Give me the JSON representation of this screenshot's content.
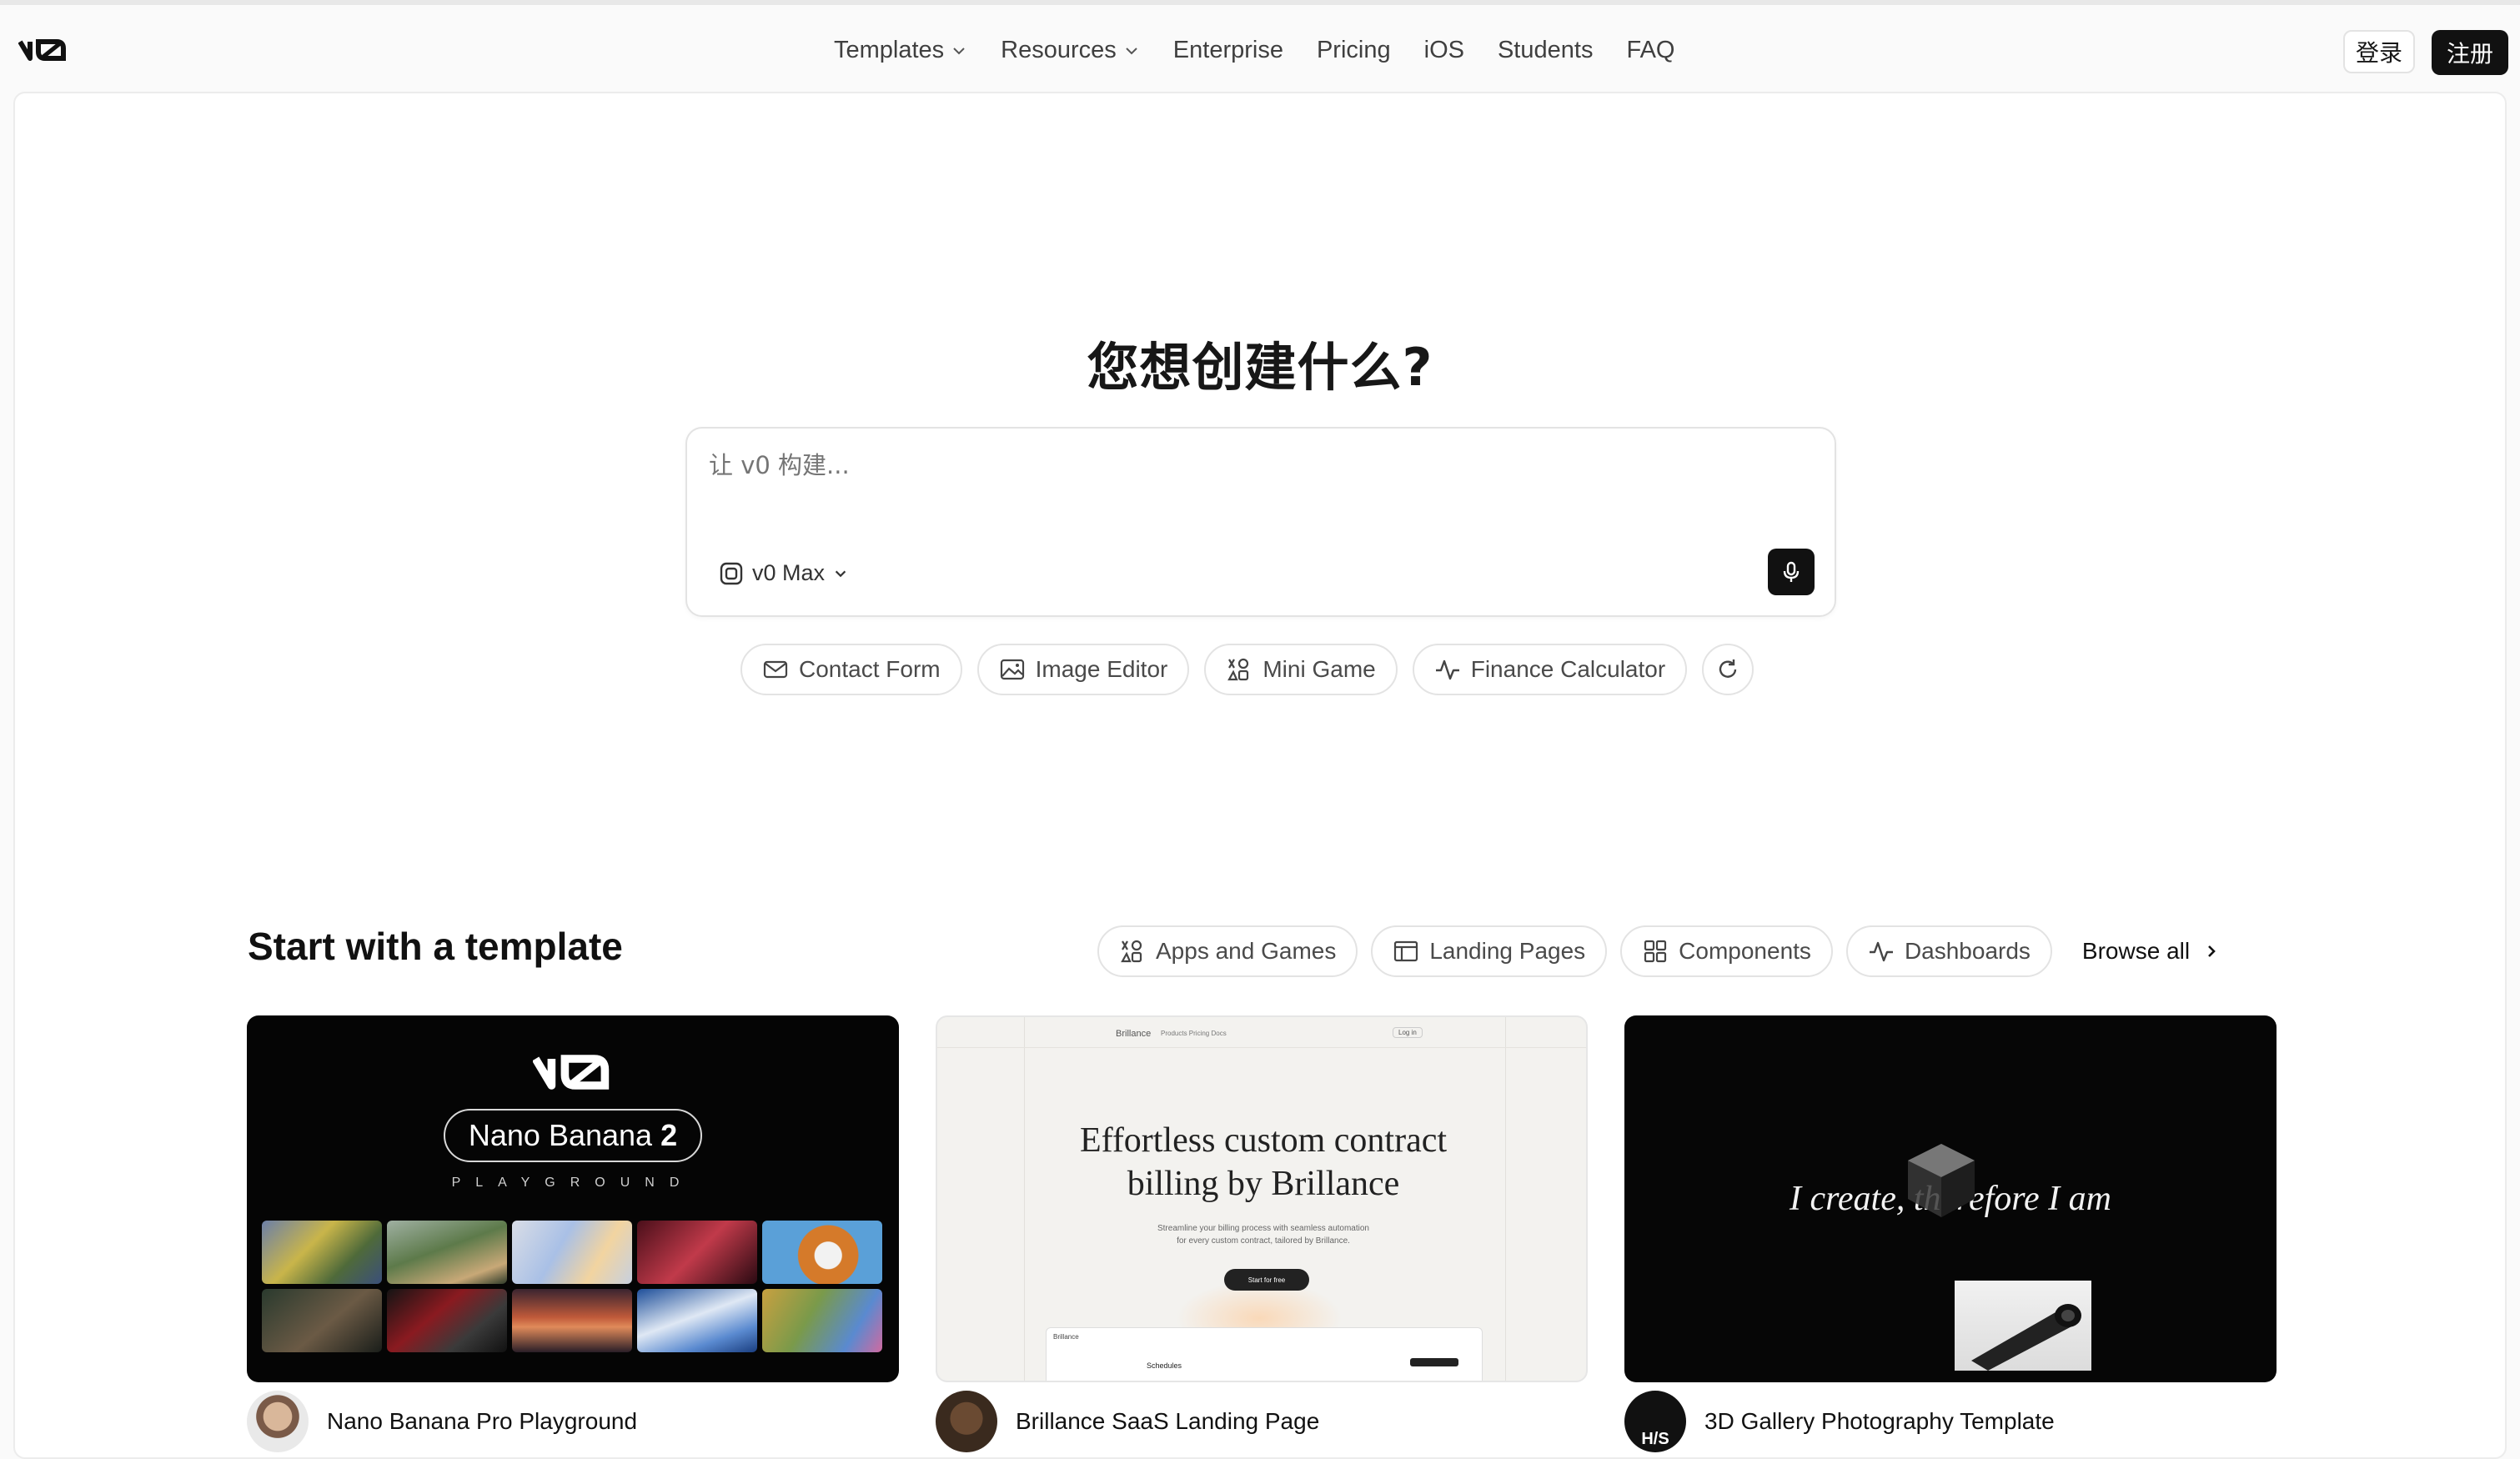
{
  "header": {
    "logo_text": "v0",
    "nav": [
      {
        "label": "Templates",
        "has_dropdown": true
      },
      {
        "label": "Resources",
        "has_dropdown": true
      },
      {
        "label": "Enterprise",
        "has_dropdown": false
      },
      {
        "label": "Pricing",
        "has_dropdown": false
      },
      {
        "label": "iOS",
        "has_dropdown": false
      },
      {
        "label": "Students",
        "has_dropdown": false
      },
      {
        "label": "FAQ",
        "has_dropdown": false
      }
    ],
    "login_label": "登录",
    "signup_label": "注册"
  },
  "hero": {
    "title": "您想创建什么?",
    "prompt_placeholder": "让 v0 构建...",
    "model_label": "v0 Max",
    "suggestions": [
      {
        "label": "Contact Form",
        "icon": "mail-icon"
      },
      {
        "label": "Image Editor",
        "icon": "image-icon"
      },
      {
        "label": "Mini Game",
        "icon": "shapes-icon"
      },
      {
        "label": "Finance Calculator",
        "icon": "activity-icon"
      }
    ]
  },
  "templates": {
    "title": "Start with a template",
    "categories": [
      {
        "label": "Apps and Games",
        "icon": "shapes-icon"
      },
      {
        "label": "Landing Pages",
        "icon": "layout-icon"
      },
      {
        "label": "Components",
        "icon": "grid-icon"
      },
      {
        "label": "Dashboards",
        "icon": "activity-icon"
      }
    ],
    "browse_all": "Browse all",
    "cards": [
      {
        "name": "Nano Banana Pro Playground",
        "preview": {
          "logo": "v0",
          "pill_text": "Nano Banana",
          "pill_number": "2",
          "subtitle": "PLAYGROUND"
        }
      },
      {
        "name": "Brillance SaaS Landing Page",
        "preview": {
          "brand": "Brillance",
          "links": "Products   Pricing   Docs",
          "login": "Log in",
          "headline_1": "Effortless custom contract",
          "headline_2": "billing by Brillance",
          "sub_1": "Streamline your billing process with seamless automation",
          "sub_2": "for every custom contract, tailored by Brillance.",
          "cta": "Start for free",
          "app_title": "Schedules"
        }
      },
      {
        "name": "3D Gallery Photography Template",
        "avatar_text": "H/S",
        "preview": {
          "quote": "I create, therefore I am"
        }
      }
    ]
  },
  "colors": {
    "accent": "#111111",
    "border": "#e3e3e3",
    "background": "#fafafa"
  }
}
